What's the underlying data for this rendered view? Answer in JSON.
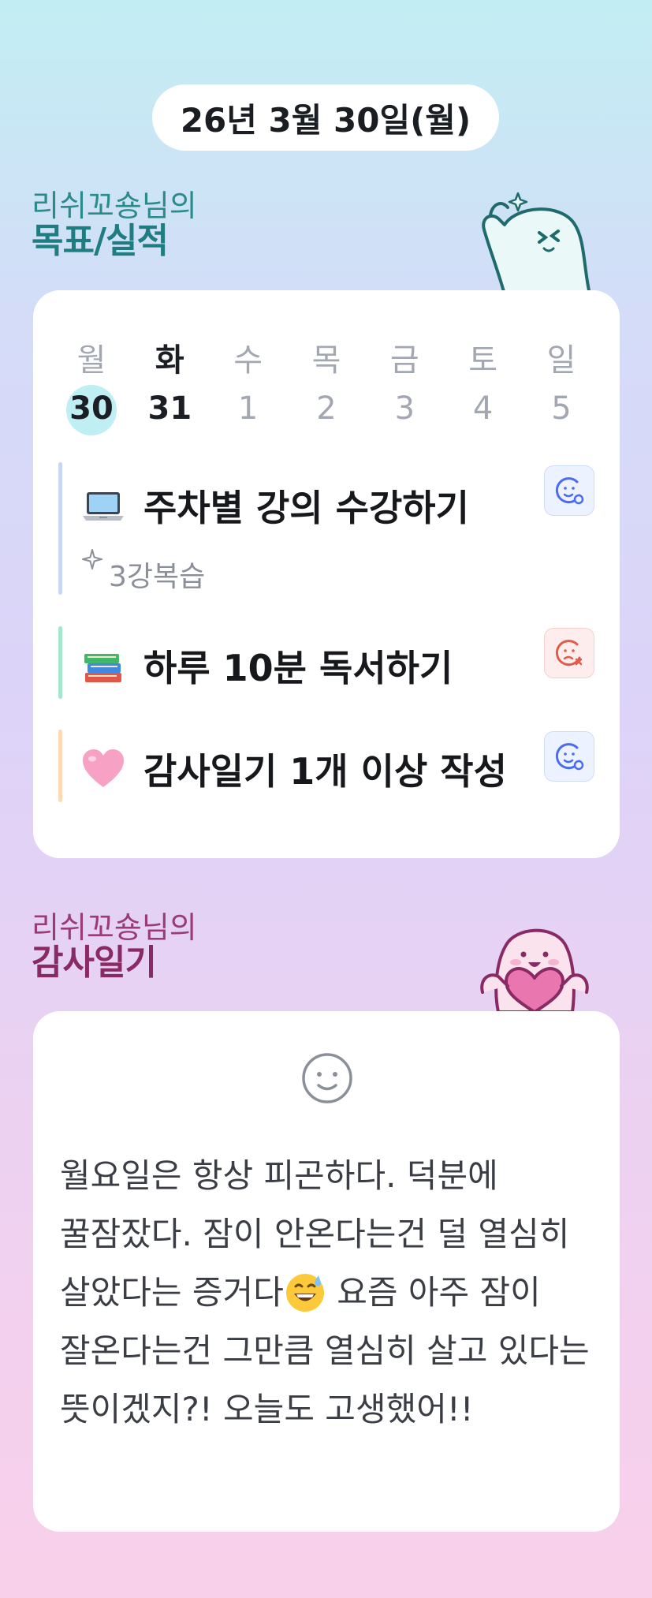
{
  "date_label": "26년 3월 30일(월)",
  "goals_section": {
    "owner_line": "리쉬꼬숑님의",
    "title": "목표/실적"
  },
  "week": [
    {
      "day": "월",
      "num": "30",
      "strong": false,
      "today": true
    },
    {
      "day": "화",
      "num": "31",
      "strong": true,
      "today": false
    },
    {
      "day": "수",
      "num": "1",
      "strong": false,
      "today": false
    },
    {
      "day": "목",
      "num": "2",
      "strong": false,
      "today": false
    },
    {
      "day": "금",
      "num": "3",
      "strong": false,
      "today": false
    },
    {
      "day": "토",
      "num": "4",
      "strong": false,
      "today": false
    },
    {
      "day": "일",
      "num": "5",
      "strong": false,
      "today": false
    }
  ],
  "goals": [
    {
      "icon": "laptop-icon",
      "title": "주차별 강의 수강하기",
      "note": "3강복습",
      "status": "achieved",
      "bar_color": "#c9d7f7"
    },
    {
      "icon": "books-icon",
      "title": "하루 10분 독서하기",
      "status": "missed",
      "bar_color": "#a6e6cc"
    },
    {
      "icon": "pink-heart-icon",
      "title": "감사일기 1개 이상 작성",
      "status": "achieved",
      "bar_color": "#ffd9b3"
    }
  ],
  "gratitude_section": {
    "owner_line": "리쉬꼬숑님의",
    "title": "감사일기"
  },
  "diary": {
    "mood_icon": "smile-face-icon",
    "text_before_emoji": "월요일은 항상 피곤하다. 덕분에 꿀잠잤다. 잠이 안온다는건 덜 열심히 살았다는 증거다",
    "inline_emoji": "grinning-sweat-emoji",
    "text_after_emoji": " 요즘 아주 잠이 잘온다는건 그만큼 열심히 살고 있다는 뜻이겠지?! 오늘도 고생했어!!"
  },
  "colors": {
    "goal_heading": "#1f7c80",
    "gratitude_heading": "#8a2a64",
    "achieved": "#4a6cf0",
    "missed": "#e45a4a"
  }
}
